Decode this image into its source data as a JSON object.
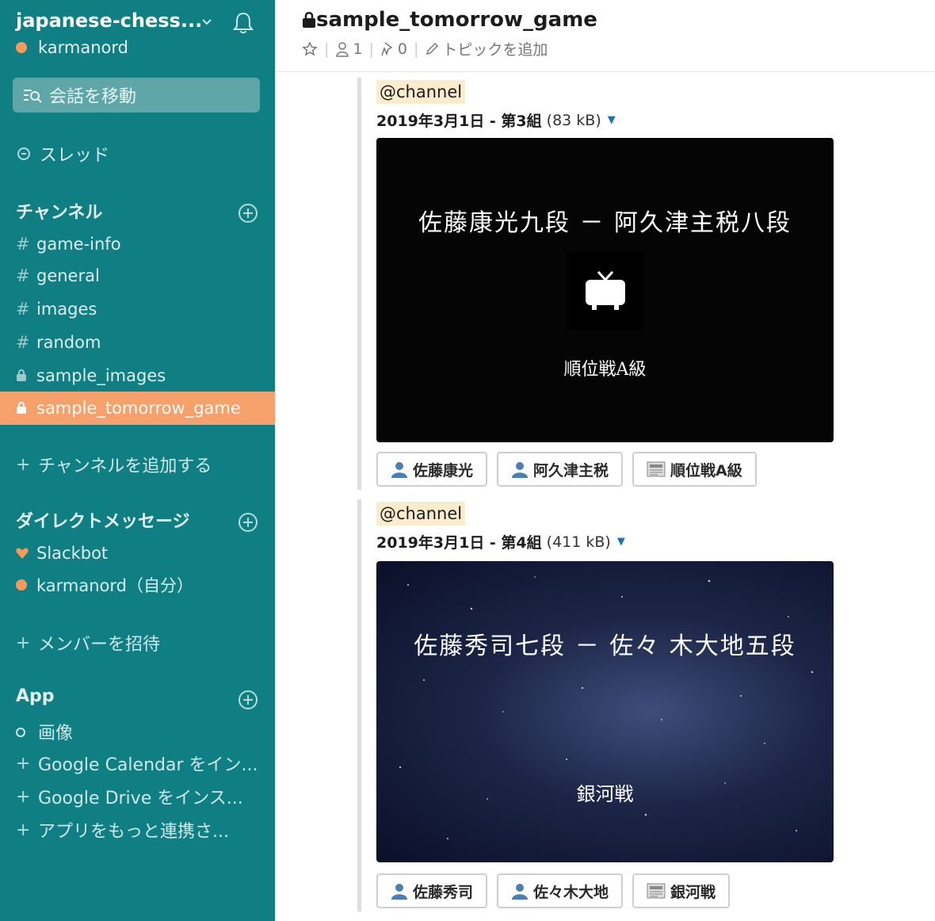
{
  "workspace": {
    "name": "japanese-chess...",
    "user": "karmanord"
  },
  "sidebar": {
    "jump_label": "会話を移動",
    "threads_label": "スレッド",
    "channels_header": "チャンネル",
    "channels": [
      {
        "label": "game-info",
        "type": "public",
        "active": false
      },
      {
        "label": "general",
        "type": "public",
        "active": false
      },
      {
        "label": "images",
        "type": "public",
        "active": false
      },
      {
        "label": "random",
        "type": "public",
        "active": false
      },
      {
        "label": "sample_images",
        "type": "private",
        "active": false
      },
      {
        "label": "sample_tomorrow_game",
        "type": "private",
        "active": true
      }
    ],
    "add_channel": "チャンネルを追加する",
    "dm_header": "ダイレクトメッセージ",
    "dms": [
      {
        "label": "Slackbot",
        "icon": "heart-icon"
      },
      {
        "label": "karmanord（自分）",
        "icon": "presence-dot-icon"
      }
    ],
    "invite": "メンバーを招待",
    "app_header": "App",
    "apps": [
      {
        "label": "画像",
        "icon": "circle-icon"
      },
      {
        "label": "Google Calendar をイン...",
        "icon": "plus-icon"
      },
      {
        "label": "Google Drive をインス...",
        "icon": "plus-icon"
      },
      {
        "label": "アプリをもっと連携さ...",
        "icon": "plus-icon"
      }
    ]
  },
  "channel": {
    "name": "sample_tomorrow_game",
    "members": "1",
    "pins": "0",
    "add_topic": "トピックを追加"
  },
  "messages": [
    {
      "mention": "@channel",
      "file_title": "2019年3月1日 - 第3組",
      "file_size": "(83 kB)",
      "preview_title": "佐藤康光九段 － 阿久津主税八段",
      "preview_sub": "順位戦A級",
      "buttons": [
        "佐藤康光",
        "阿久津主税",
        "順位戦A級"
      ]
    },
    {
      "mention": "@channel",
      "file_title": "2019年3月1日 - 第4組",
      "file_size": "(411 kB)",
      "preview_title": "佐藤秀司七段 － 佐々 木大地五段",
      "preview_sub": "銀河戦",
      "buttons": [
        "佐藤秀司",
        "佐々木大地",
        "銀河戦"
      ]
    }
  ],
  "colors": {
    "sidebar": "#0f7f84",
    "active": "#f6a06b",
    "presence": "#f79a59"
  }
}
